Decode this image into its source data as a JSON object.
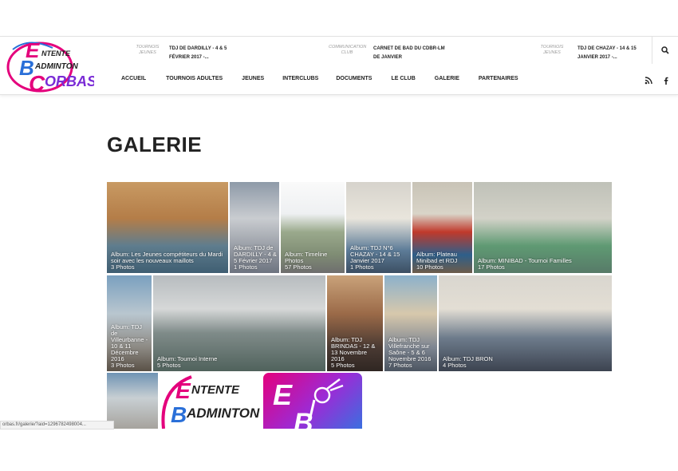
{
  "header": {
    "logo_text": [
      "ENTENTE",
      "ADMINTON",
      "ORBAS"
    ],
    "tickers": [
      {
        "category": "TOURNOIS JEUNES",
        "title": "TDJ DE DARDILLY - 4 & 5 FÉVRIER 2017 -..."
      },
      {
        "category": "COMMUNICATION CLUB",
        "title": "CARNET DE BAD DU CDBR-LM DE JANVIER"
      },
      {
        "category": "TOURNOIS JEUNES",
        "title": "TDJ DE CHAZAY - 14 & 15 JANVIER 2017 -..."
      }
    ],
    "nav": [
      "ACCUEIL",
      "TOURNOIS ADULTES",
      "JEUNES",
      "INTERCLUBS",
      "DOCUMENTS",
      "LE CLUB",
      "GALERIE",
      "PARTENAIRES"
    ],
    "icons": {
      "search": "search-icon",
      "rss": "rss-icon",
      "facebook": "facebook-icon"
    }
  },
  "page": {
    "title": "GALERIE"
  },
  "albums": [
    {
      "title": "Album: Les Jeunes compétiteurs du Mardi soir avec les nouveaux maillots",
      "count": "3 Photos"
    },
    {
      "title": "Album: TDJ de DARDILLY - 4 & 5 Février 2017",
      "count": "1 Photos"
    },
    {
      "title": "Album: Timeline Photos",
      "count": "57 Photos"
    },
    {
      "title": "Album: TDJ N°6 CHAZAY - 14 & 15 Janvier 2017",
      "count": "1 Photos"
    },
    {
      "title": "Album: Plateau Minibad et RDJ",
      "count": "10 Photos"
    },
    {
      "title": "Album: MINIBAD - Tournoi Familles",
      "count": "17 Photos"
    },
    {
      "title": "Album: TDJ de Villeurbanne - 10 & 11 Décembre 2016",
      "count": "3 Photos"
    },
    {
      "title": "Album: Tournoi Interne",
      "count": "5 Photos"
    },
    {
      "title": "Album: TDJ BRINDAS - 12 & 13 Novembre 2016",
      "count": "5 Photos"
    },
    {
      "title": "Album: TDJ Villefranche sur Saône - 5 & 6 Novembre 2016",
      "count": "7 Photos"
    },
    {
      "title": "Album: TDJ BRON",
      "count": "4 Photos"
    }
  ],
  "status_bar": {
    "url": "orbas.fr/galerie/?aid=1296782498004..."
  },
  "colors": {
    "logo_pink": "#e4007c",
    "logo_blue": "#2a6fd8",
    "logo_purple": "#7a2bd6",
    "text": "#222222"
  }
}
